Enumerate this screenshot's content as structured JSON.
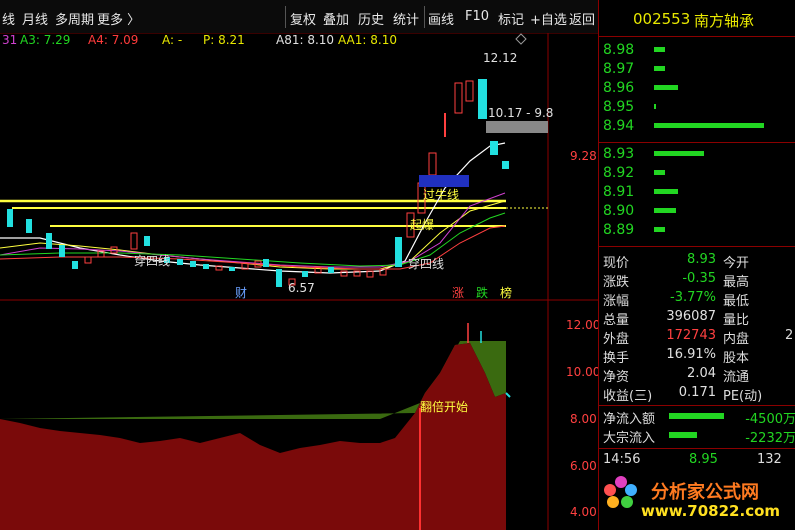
{
  "toolbar": {
    "left": [
      "线",
      "月线",
      "多周期",
      "更多 〉"
    ],
    "right": [
      "复权",
      "叠加",
      "历史",
      "统计",
      "画线",
      "F10",
      "标记",
      "+自选",
      "返回"
    ]
  },
  "indicators": {
    "n": "31",
    "a3": "A3: 7.29",
    "a4": "A4: 7.09",
    "a": "A: -",
    "p": "P: 8.21",
    "a81": "A81: 8.10",
    "aa1": "AA1: 8.10"
  },
  "chart_labels": {
    "high_price": "12.12",
    "range_price": "10.17 - 9.8",
    "right_axis_price": "9.28",
    "low_price": "6.57",
    "chuan_si_xian_1": "穿四线",
    "chuan_si_xian_2": "穿四线",
    "guo_niu_xian": "过牛线",
    "qi_bao": "起爆",
    "cai": "财",
    "zhang": "涨",
    "die": "跌",
    "bang": "榜",
    "fan_bei": "翻倍开始"
  },
  "lower_axis": [
    "12.00",
    "10.00",
    "8.00",
    "6.00",
    "4.00"
  ],
  "quote": {
    "code": "002553",
    "name": "南方轴承",
    "asks": [
      {
        "price": "8.98",
        "bar": 0.1
      },
      {
        "price": "8.97",
        "bar": 0.1
      },
      {
        "price": "8.96",
        "bar": 0.22
      },
      {
        "price": "8.95",
        "bar": 0.02
      },
      {
        "price": "8.94",
        "bar": 1.0
      }
    ],
    "bids": [
      {
        "price": "8.93",
        "bar": 0.45
      },
      {
        "price": "8.92",
        "bar": 0.1
      },
      {
        "price": "8.91",
        "bar": 0.22
      },
      {
        "price": "8.90",
        "bar": 0.2
      },
      {
        "price": "8.89",
        "bar": 0.1
      }
    ],
    "rows": [
      {
        "label": "现价",
        "value": "8.93",
        "label2": "今开"
      },
      {
        "label": "涨跌",
        "value": "-0.35",
        "label2": "最高"
      },
      {
        "label": "涨幅",
        "value": "-3.77%",
        "label2": "最低"
      },
      {
        "label": "总量",
        "value": "396087",
        "label2": "量比"
      },
      {
        "label": "外盘",
        "value": "172743",
        "label2": "内盘",
        "extra": "2"
      },
      {
        "label": "换手",
        "value": "16.91%",
        "label2": "股本"
      },
      {
        "label": "净资",
        "value": "2.04",
        "label2": "流通"
      },
      {
        "label": "收益(三)",
        "value": "0.171",
        "label2": "PE(动)"
      }
    ],
    "flows": [
      {
        "label": "净流入额",
        "value": "-4500万",
        "bar": 0.6
      },
      {
        "label": "大宗流入",
        "value": "-2232万",
        "bar": 0.3
      }
    ],
    "ticks": [
      {
        "time": "14:56",
        "price": "8.95",
        "vol": "132"
      }
    ]
  },
  "watermark": {
    "title": "分析家公式网",
    "url": "www.70822.com"
  },
  "chart_data": {
    "type": "candlestick",
    "upper_right_axis": [
      "9.28"
    ],
    "lower_axis_ticks": [
      12.0,
      10.0,
      8.0,
      6.0,
      4.0
    ],
    "annotations": [
      "12.12",
      "10.17 - 9.8",
      "6.57",
      "穿四线",
      "过牛线",
      "起爆",
      "翻倍开始"
    ]
  }
}
